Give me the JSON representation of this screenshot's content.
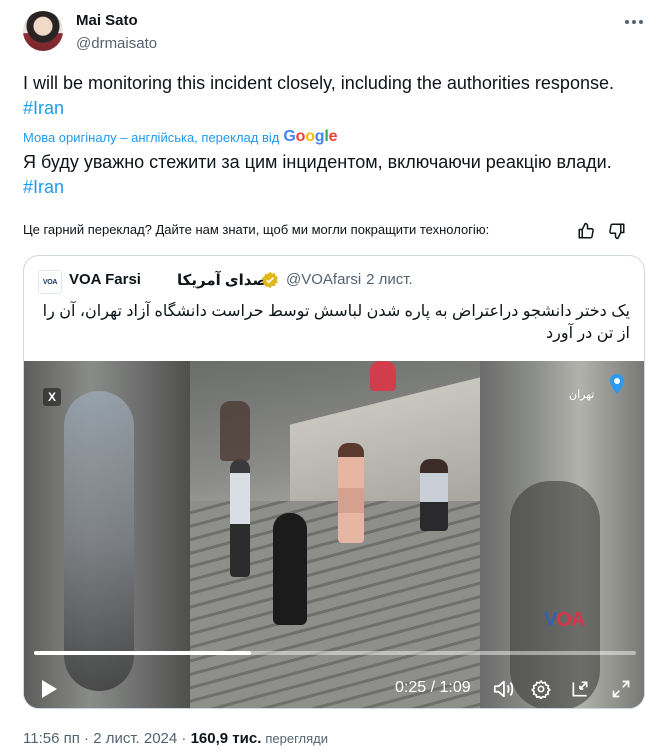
{
  "author": {
    "name": "Mai Sato",
    "handle": "@drmaisato"
  },
  "tweet": {
    "text": "I will be monitoring this incident closely, including the authorities response.",
    "hashtag": "#Iran",
    "translation_note": "Мова оригіналу – англійська, переклад від",
    "translation_provider": "Google",
    "translated_text": "Я буду уважно стежити за цим інцидентом, включаючи реакцію влади.",
    "translated_hashtag": "#Iran",
    "feedback_prompt": "Це гарний переклад? Дайте нам знати, щоб ми могли покращити технологію:"
  },
  "quoted_tweet": {
    "avatar_text": "VOA",
    "name": "VOA Farsi",
    "name_fa": "صدای آمریکا",
    "handle": "@VOAfarsi",
    "time": "· 2 лист.",
    "text": "یک دختر دانشجو دراعتراض به  پاره شدن لباسش توسط حراست دانشگاه آزاد تهران، آن را از تن در آورد",
    "video": {
      "badge": "X",
      "city_label": "تهران",
      "watermark_a": "V",
      "watermark_b": "OA",
      "current_time": "0:25",
      "duration": "1:09",
      "time_readout": "0:25 / 1:09",
      "progress": 0.36
    }
  },
  "footer": {
    "time": "11:56 пп",
    "separator": " · ",
    "date": "2 лист. 2024",
    "separator2": " · ",
    "views_count": "160,9 тис.",
    "views_label": "перегляди"
  },
  "icons": {
    "more": "more-horizontal-icon",
    "thumbs_up": "thumbs-up-icon",
    "thumbs_down": "thumbs-down-icon",
    "verified": "verified-badge-icon",
    "play": "play-icon",
    "volume": "volume-icon",
    "settings": "settings-icon",
    "miniplayer": "miniplayer-icon",
    "fullscreen": "fullscreen-icon"
  },
  "colors": {
    "link": "#1d9bf0",
    "text": "#0f1419",
    "secondary": "#536471",
    "verified_gold": "#e2b719",
    "voa_red": "#d6364a",
    "voa_blue": "#3b5fa8"
  }
}
